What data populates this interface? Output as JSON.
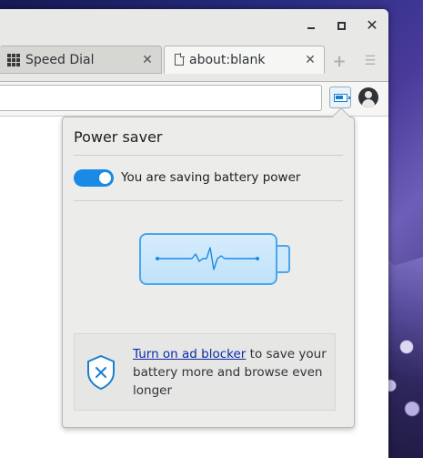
{
  "window_controls": {
    "minimize": "minimize",
    "maximize": "maximize",
    "close": "✕"
  },
  "tabs": [
    {
      "label": "Speed Dial",
      "icon": "speed-dial-grid-icon",
      "close": "✕"
    },
    {
      "label": "about:blank",
      "icon": "document-icon",
      "close": "✕"
    }
  ],
  "toolbar": {
    "new_tab": "+",
    "tab_menu": "☰"
  },
  "address": {
    "value": "",
    "placeholder": ""
  },
  "popup": {
    "title": "Power saver",
    "toggle_state": "on",
    "toggle_label": "You are saving battery power",
    "illustration": "battery-pulse-icon",
    "ad_blocker_link": "Turn on ad blocker",
    "ad_blocker_text": " to save your battery more and browse even longer"
  },
  "colors": {
    "accent": "#1a8ae6",
    "battery_outline": "#4aa6ee",
    "link": "#0b2ba8"
  }
}
